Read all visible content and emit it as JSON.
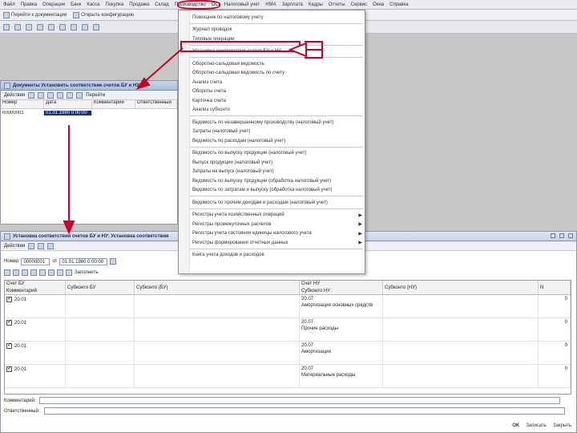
{
  "menubar": {
    "items": [
      "Файл",
      "Правка",
      "Операции",
      "Банк",
      "Касса",
      "Покупка",
      "Продажа",
      "Склад",
      "Производство",
      "ОС",
      "НМА",
      "Зарплата",
      "Кадры",
      "Отчеты",
      "Сервис",
      "Окна",
      "Справка"
    ],
    "active_item": "Налоговый учет"
  },
  "toolbar1": {
    "label": "Перейти к документации",
    "open_config": "Открыть конфигурацию"
  },
  "doclist": {
    "title": "Документы Установить соответствие счетов БУ и НУ",
    "actions_label": "Действия",
    "goto_label": "Перейти",
    "columns": [
      "Номер",
      "Дата",
      "Комментарий",
      "Ответственный"
    ],
    "rows": [
      {
        "number": "00000001",
        "date": "01.01.1980 0:00:00"
      }
    ]
  },
  "dropdown": {
    "items": [
      {
        "label": "Помощник по налоговому учету",
        "arrow": false
      },
      {
        "label": "Журнал проводок",
        "arrow": false
      },
      {
        "label": "Типовые операции",
        "arrow": false
      },
      {
        "label": "Установка соответствия счетов БУ и НУ",
        "arrow": false
      },
      {
        "label": "Оборотно-сальдовая ведомость",
        "arrow": false
      },
      {
        "label": "Оборотно-сальдовая ведомость по счету",
        "arrow": false
      },
      {
        "label": "Анализ счета",
        "arrow": false
      },
      {
        "label": "Обороты счета",
        "arrow": false
      },
      {
        "label": "Карточка счета",
        "arrow": false
      },
      {
        "label": "Анализ субконто",
        "arrow": false
      },
      {
        "label": "Ведомость по незавершенному производству (налоговый учет)",
        "arrow": false
      },
      {
        "label": "Затраты (налоговый учет)",
        "arrow": false
      },
      {
        "label": "Ведомость по расходам (налоговый учет)",
        "arrow": false
      },
      {
        "label": "Ведомость по выпуску продукции (налоговый учет)",
        "arrow": false
      },
      {
        "label": "Выпуск продукции (налоговый учет)",
        "arrow": false
      },
      {
        "label": "Затраты на выпуск (налоговый учет)",
        "arrow": false
      },
      {
        "label": "Ведомость по выпуску продукции (обработка налоговый учет)",
        "arrow": false
      },
      {
        "label": "Ведомость по затратам и выпуску (обработка налоговый учет)",
        "arrow": false
      },
      {
        "label": "Ведомость по прочим доходам и расходам (налоговый учет)",
        "arrow": false
      },
      {
        "label": "Регистры учета хозяйственных операций",
        "arrow": true
      },
      {
        "label": "Регистры промежуточных расчетов",
        "arrow": true
      },
      {
        "label": "Регистры учета состояния единицы налогового учета",
        "arrow": true
      },
      {
        "label": "Регистры формирования отчетных данных",
        "arrow": true
      },
      {
        "label": "Книга учета доходов и расходов",
        "arrow": false
      }
    ]
  },
  "formwin": {
    "title": "Установка соответствия счетов БУ и НУ: Установка соответствия",
    "actions_label": "Действия",
    "number_label": "Номер",
    "number_value": "00000001",
    "date_label": "от",
    "date_value": "01.01.1980 0:00:00",
    "fill_label": "Заполнить",
    "columns": {
      "c1_top": "Счет БУ",
      "c1_bottom": "Комментарий",
      "c2_top": "Субконто БУ",
      "c3_top": "Субконто (БУ)",
      "c4_top": "Счет НУ",
      "c4_bottom": "Субконто НУ",
      "c5_top": "Субконто (НУ)",
      "c6_top": "N"
    },
    "rows": [
      {
        "acc_bu": "20.01",
        "acc_nu": "20.07",
        "desc": "Амортизация основных средств",
        "desc2": ""
      },
      {
        "acc_bu": "20.01",
        "acc_nu": "20.07",
        "desc": "Прочие расходы",
        "desc2": ""
      },
      {
        "acc_bu": "20.01",
        "acc_nu": "20.07",
        "desc": "Амортизация",
        "desc2": ""
      },
      {
        "acc_bu": "20.01",
        "acc_nu": "20.07",
        "desc": "Материальные расходы",
        "desc2": ""
      }
    ],
    "row_nums": [
      "0",
      "0",
      "0",
      "0"
    ],
    "comment_label": "Комментарий:",
    "responsible_label": "Ответственный:",
    "ok_label": "OK",
    "write_label": "Записать",
    "close_label": "Закрыть"
  },
  "colors": {
    "annotation": "#c8002a",
    "selection": "#0b2e86"
  }
}
